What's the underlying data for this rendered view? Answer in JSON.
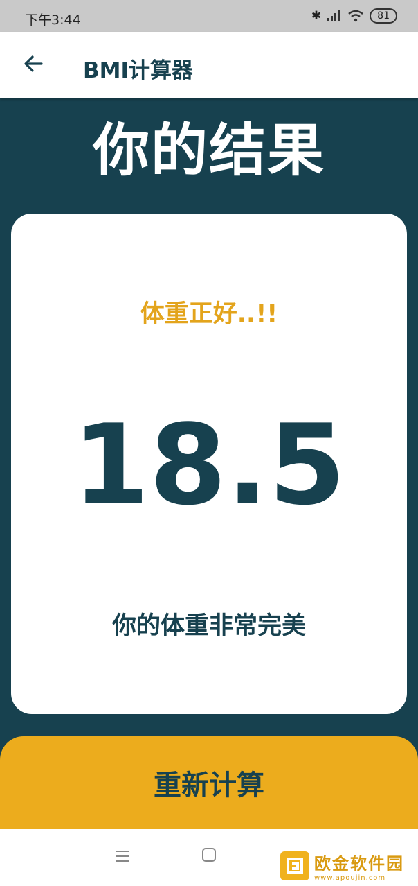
{
  "status_bar": {
    "time": "下午3:44",
    "battery": "81",
    "icons": [
      "bluetooth-icon",
      "signal-icon",
      "wifi-icon",
      "battery-icon"
    ]
  },
  "app_bar": {
    "title": "BMI计算器",
    "back_icon": "arrow-left-icon"
  },
  "result": {
    "heading": "你的结果",
    "status": "体重正好..!!",
    "bmi": "18.5",
    "advice": "你的体重非常完美"
  },
  "actions": {
    "recalculate_label": "重新计算"
  },
  "nav_bar": {
    "icons": [
      "menu-icon",
      "home-icon"
    ]
  },
  "watermark": {
    "text": "欧金软件园",
    "url": "www.apoujin.com"
  },
  "colors": {
    "background": "#17414f",
    "accent": "#ecac1d",
    "status_text": "#e3a41c",
    "card": "#ffffff"
  }
}
